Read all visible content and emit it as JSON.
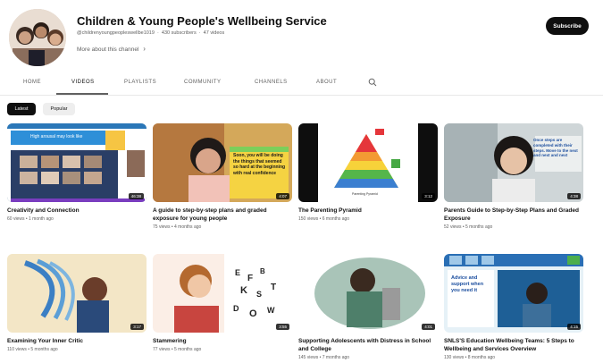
{
  "channel": {
    "name": "Children & Young People's Wellbeing Service",
    "handle": "@childrenyoungpeopleswellbe1019",
    "subscribers": "430 subscribers",
    "video_count": "47 videos",
    "more_label": "More about this channel",
    "subscribe_label": "Subscribe"
  },
  "tabs": [
    {
      "label": "HOME"
    },
    {
      "label": "VIDEOS"
    },
    {
      "label": "PLAYLISTS"
    },
    {
      "label": "COMMUNITY"
    },
    {
      "label": "CHANNELS"
    },
    {
      "label": "ABOUT"
    }
  ],
  "filters": {
    "latest": "Latest",
    "popular": "Popular"
  },
  "videos": [
    {
      "title": "Creativity and Connection",
      "meta": "60 views • 1 month ago",
      "duration": "46:38",
      "thumb_text": "High arousal may look like"
    },
    {
      "title": "A guide to step-by-step plans and graded exposure for young people",
      "meta": "75 views • 4 months ago",
      "duration": "4:07",
      "thumb_text": "Soon, you will be doing the things that seemed so hard at the beginning with real confidence"
    },
    {
      "title": "The Parenting Pyramid",
      "meta": "150 views • 6 months ago",
      "duration": "3:12",
      "thumb_text": "Parenting Pyramid"
    },
    {
      "title": "Parents Guide to Step-by-Step Plans and Graded Exposure",
      "meta": "52 views • 5 months ago",
      "duration": "4:38",
      "thumb_text": "Once steps are completed with their steps. Move to the next and next and next"
    },
    {
      "title": "Examining Your Inner Critic",
      "meta": "110 views • 5 months ago",
      "duration": "3:17"
    },
    {
      "title": "Stammering",
      "meta": "77 views • 5 months ago",
      "duration": "3:55"
    },
    {
      "title": "Supporting Adolescents with Distress in School and College",
      "meta": "145 views • 7 months ago",
      "duration": "4:01"
    },
    {
      "title": "SNLS'S Education Wellbeing Teams: 5 Steps to Wellbeing and Services Overview",
      "meta": "130 views • 8 months ago",
      "duration": "4:15",
      "thumb_text": "Advice and support when you need it"
    }
  ],
  "colors": {
    "subscribe_bg": "#0f0f0f",
    "chip_active_bg": "#0f0f0f",
    "chip_bg": "#eeeeee",
    "meta_text": "#606060"
  }
}
